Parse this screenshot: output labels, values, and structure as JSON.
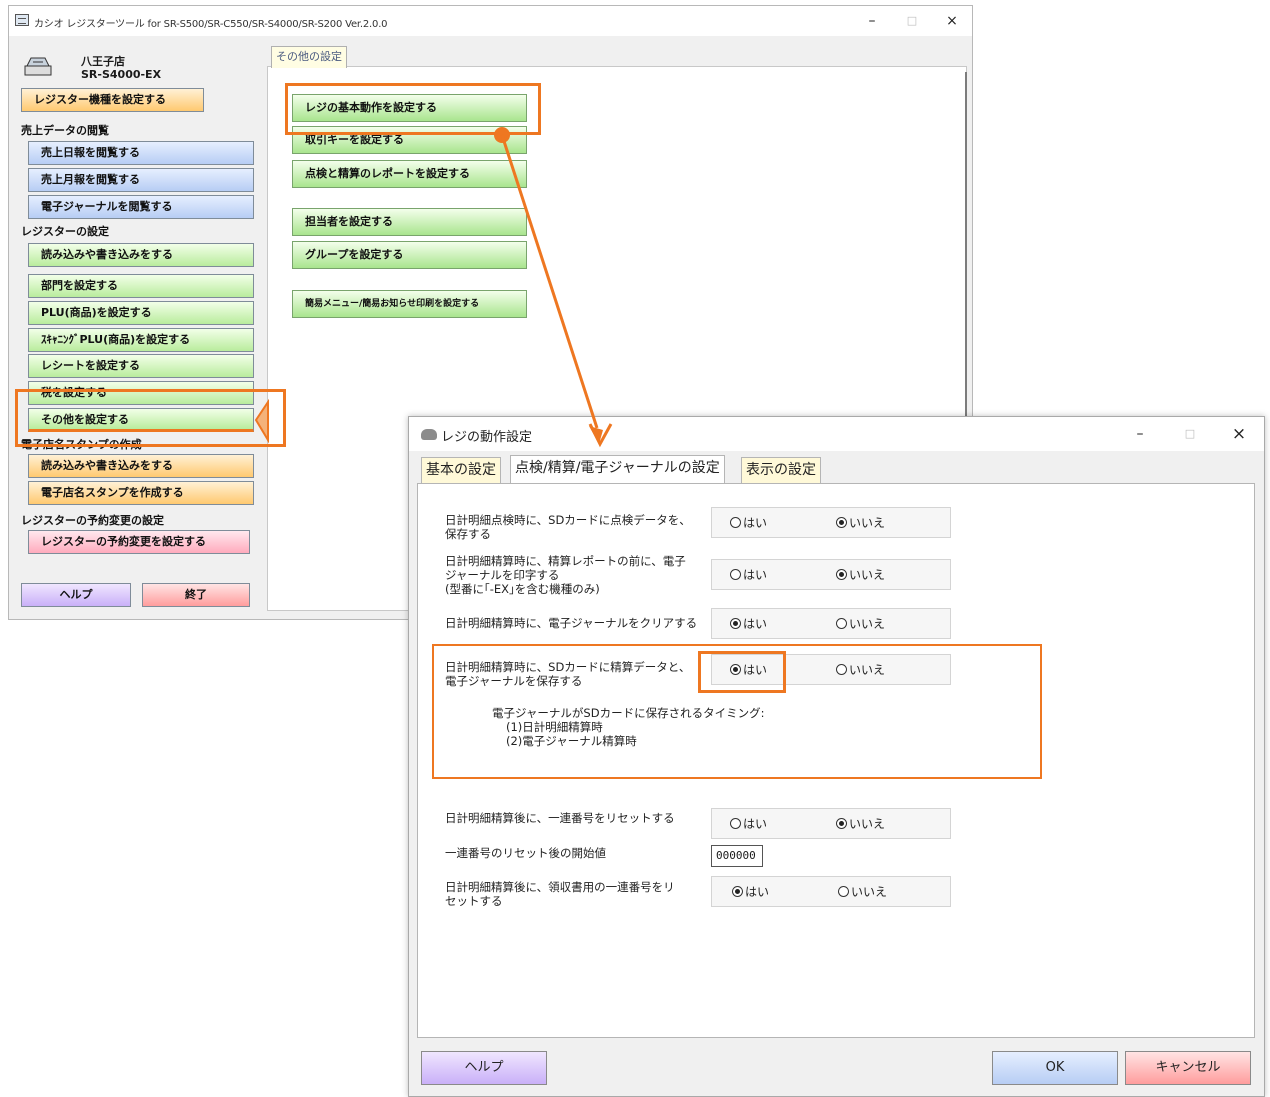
{
  "main_window": {
    "title": "カシオ レジスターツール for SR-S500/SR-C550/SR-S4000/SR-S200 Ver.2.0.0",
    "controls": {
      "minimize": "–",
      "maximize": "□",
      "close": "×"
    },
    "store_name": "八王子店",
    "model": "SR-S4000-EX",
    "set_model_button": "レジスター機種を設定する",
    "sections": {
      "sales": "売上データの閲覧",
      "register": "レジスターの設定",
      "stamp": "電子店名スタンプの作成",
      "schedule": "レジスターの予約変更の設定"
    },
    "sales_buttons": [
      "売上日報を閲覧する",
      "売上月報を閲覧する",
      "電子ジャーナルを閲覧する"
    ],
    "register_buttons": [
      "読み込みや書き込みをする",
      "部門を設定する",
      "PLU(商品)を設定する",
      "ｽｷｬﾆﾝｸﾞPLU(商品)を設定する",
      "レシートを設定する",
      "税を設定する",
      "その他を設定する"
    ],
    "stamp_buttons": [
      "読み込みや書き込みをする",
      "電子店名スタンプを作成する"
    ],
    "schedule_button": "レジスターの予約変更を設定する",
    "help_button": "ヘルプ",
    "exit_button": "終了",
    "tab_label": "その他の設定",
    "action_buttons": [
      "レジの基本動作を設定する",
      "取引キーを設定する",
      "点検と精算のレポートを設定する",
      "担当者を設定する",
      "グループを設定する",
      "簡易メニュー/簡易お知らせ印刷を設定する"
    ]
  },
  "dialog": {
    "title": "レジの動作設定",
    "controls": {
      "minimize": "–",
      "maximize": "□",
      "close": "×"
    },
    "tabs": [
      "基本の設定",
      "点検/精算/電子ジャーナルの設定",
      "表示の設定"
    ],
    "yes_label": "はい",
    "no_label": "いいえ",
    "settings": [
      {
        "line1": "日計明細点検時に、SDカードに点検データを、",
        "line2": "保存する",
        "line3": "",
        "selected": "no"
      },
      {
        "line1": "日計明細精算時に、精算レポートの前に、電子",
        "line2": "ジャーナルを印字する",
        "line3": "(型番に｢-EX｣を含む機種のみ)",
        "selected": "no"
      },
      {
        "line1": "日計明細精算時に、電子ジャーナルをクリアする",
        "line2": "",
        "line3": "",
        "selected": "yes"
      },
      {
        "line1": "日計明細精算時に、SDカードに精算データと、",
        "line2": "電子ジャーナルを保存する",
        "line3": "",
        "selected": "yes"
      },
      {
        "line1": "日計明細精算後に、一連番号をリセットする",
        "line2": "",
        "line3": "",
        "selected": "no"
      },
      {
        "line1": "日計明細精算後に、領収書用の一連番号をリ",
        "line2": "セットする",
        "line3": "",
        "selected": "yes"
      }
    ],
    "timing_note": {
      "heading": "電子ジャーナルがSDカードに保存されるタイミング:",
      "item1": "(1)日計明細精算時",
      "item2": "(2)電子ジャーナル精算時"
    },
    "serial_start_label": "一連番号のリセット後の開始値",
    "serial_start_value": "000000",
    "help_button": "ヘルプ",
    "ok_button": "OK",
    "cancel_button": "キャンセル"
  },
  "colors": {
    "highlight": "#ee7721"
  }
}
